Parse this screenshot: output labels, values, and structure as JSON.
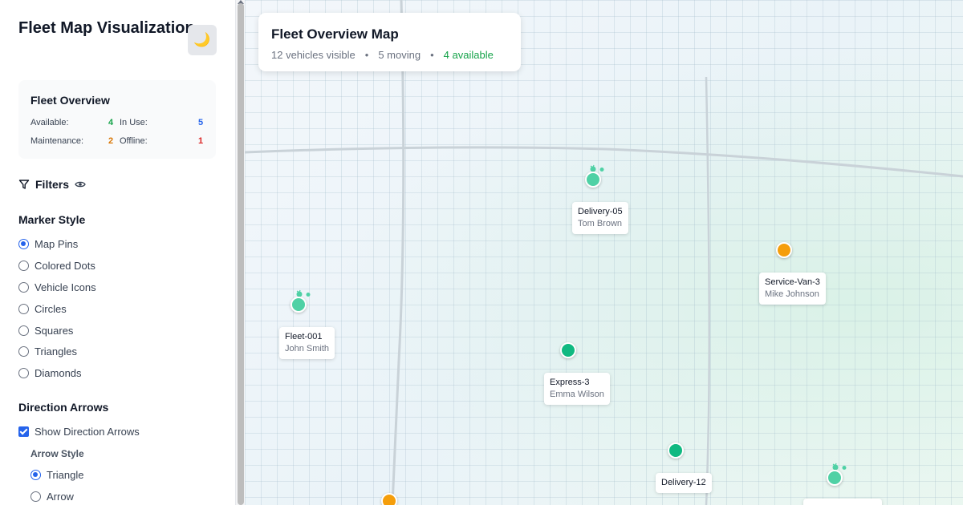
{
  "app": {
    "title": "Fleet Map Visualization",
    "theme_icon": "moon-icon",
    "theme_glyph": "🌙"
  },
  "fleet_overview": {
    "title": "Fleet Overview",
    "stats": [
      {
        "label": "Available:",
        "value": "4",
        "color": "#16a34a"
      },
      {
        "label": "In Use:",
        "value": "5",
        "color": "#2563eb"
      },
      {
        "label": "Maintenance:",
        "value": "2",
        "color": "#d97706"
      },
      {
        "label": "Offline:",
        "value": "1",
        "color": "#dc2626"
      }
    ]
  },
  "filters": {
    "label": "Filters"
  },
  "marker_style": {
    "title": "Marker Style",
    "selected": "Map Pins",
    "options": [
      "Map Pins",
      "Colored Dots",
      "Vehicle Icons",
      "Circles",
      "Squares",
      "Triangles",
      "Diamonds"
    ]
  },
  "direction_arrows": {
    "title": "Direction Arrows",
    "show_label": "Show Direction Arrows",
    "show_checked": true,
    "arrow_style_title": "Arrow Style",
    "arrow_options": [
      "Triangle",
      "Arrow"
    ],
    "arrow_selected": "Triangle"
  },
  "map": {
    "overview_title": "Fleet Overview Map",
    "visible": "12 vehicles visible",
    "moving": "5 moving",
    "available": "4 available",
    "separator": "•",
    "vehicles": [
      {
        "name": "Delivery-05",
        "driver": "Tom Brown",
        "status": "available",
        "color": "#4fd1a5",
        "moving": true
      },
      {
        "name": "Service-Van-3",
        "driver": "Mike Johnson",
        "status": "maintenance",
        "color": "#f59e0b",
        "moving": false
      },
      {
        "name": "Fleet-001",
        "driver": "John Smith",
        "status": "available",
        "color": "#4fd1a5",
        "moving": true
      },
      {
        "name": "Express-3",
        "driver": "Emma Wilson",
        "status": "in-use",
        "color": "#10b981",
        "moving": false
      },
      {
        "name": "Delivery-12",
        "driver": "",
        "status": "in-use",
        "color": "#10b981",
        "moving": false
      },
      {
        "name": "",
        "driver": "",
        "status": "available",
        "color": "#4fd1a5",
        "moving": true
      },
      {
        "name": "",
        "driver": "",
        "status": "maintenance",
        "color": "#f59e0b",
        "moving": false
      }
    ]
  }
}
